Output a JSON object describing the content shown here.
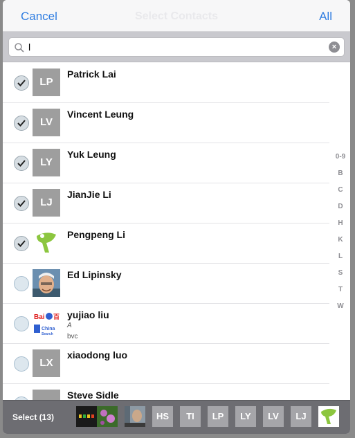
{
  "nav": {
    "cancel": "Cancel",
    "title": "Select Contacts",
    "all": "All"
  },
  "search": {
    "value": "l"
  },
  "contacts": [
    {
      "name": "Patrick Lai",
      "initials": "LP",
      "selected": true
    },
    {
      "name": "Vincent Leung",
      "initials": "LV",
      "selected": true
    },
    {
      "name": "Yuk Leung",
      "initials": "LY",
      "selected": true
    },
    {
      "name": "JianJie Li",
      "initials": "LJ",
      "selected": true
    },
    {
      "name": "Pengpeng Li",
      "initials": "",
      "photo": "green-logo",
      "selected": true
    },
    {
      "name": "Ed Lipinsky",
      "initials": "",
      "photo": "person-photo",
      "selected": false
    },
    {
      "name": "yujiao liu",
      "initials": "",
      "photo": "baidu-logo",
      "selected": false,
      "sub1": "A",
      "sub2": "bvc"
    },
    {
      "name": "xiaodong luo",
      "initials": "LX",
      "selected": false
    },
    {
      "name": "Steve Sidle",
      "initials": "",
      "selected": false
    }
  ],
  "index": [
    "0-9",
    "B",
    "C",
    "D",
    "H",
    "K",
    "L",
    "S",
    "T",
    "W"
  ],
  "bottom": {
    "select_label": "Select (13)",
    "thumbs": [
      {
        "label": "",
        "photo": "dark-pattern"
      },
      {
        "label": "",
        "photo": "flowers-photo"
      },
      {
        "label": "",
        "photo": "person-photo"
      },
      {
        "label": "HS"
      },
      {
        "label": "TI"
      },
      {
        "label": "LP"
      },
      {
        "label": "LY"
      },
      {
        "label": "LV"
      },
      {
        "label": "LJ"
      },
      {
        "label": "",
        "photo": "green-logo"
      }
    ]
  },
  "colors": {
    "accent": "#2f7de1",
    "avatar_gray": "#9e9e9e",
    "bar_gray": "#6d6d72"
  }
}
